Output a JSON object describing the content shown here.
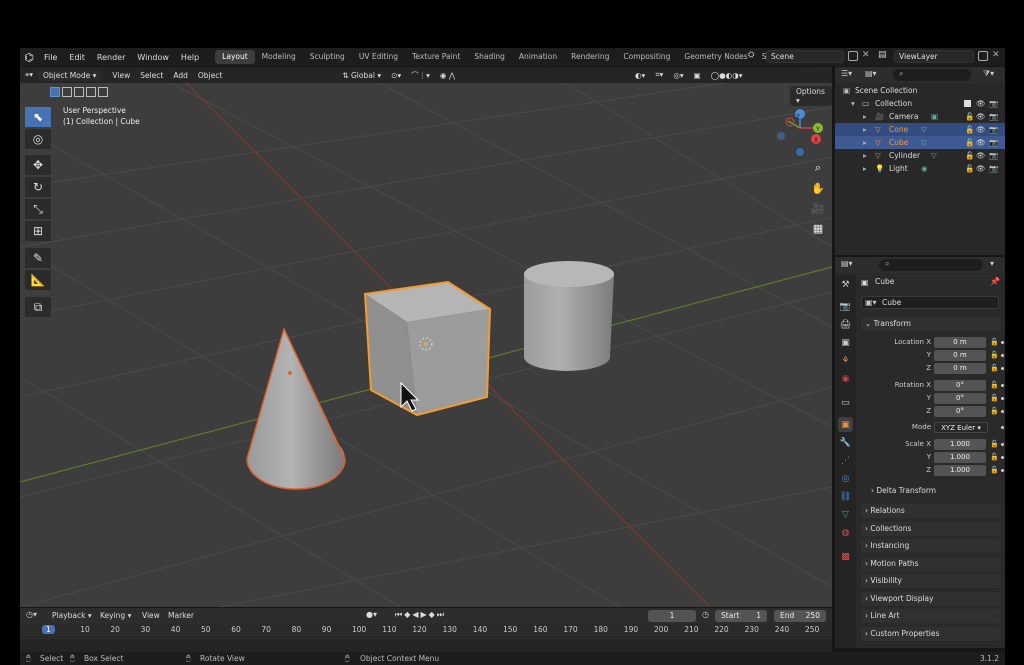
{
  "menu": [
    "File",
    "Edit",
    "Render",
    "Window",
    "Help"
  ],
  "workspaces": [
    "Layout",
    "Modeling",
    "Sculpting",
    "UV Editing",
    "Texture Paint",
    "Shading",
    "Animation",
    "Rendering",
    "Compositing",
    "Geometry Nodes",
    "Scripting"
  ],
  "workspace_add": "+",
  "scene": {
    "label": "Scene",
    "view_layer": "ViewLayer"
  },
  "viewport": {
    "mode": "Object Mode",
    "menus": [
      "View",
      "Select",
      "Add",
      "Object"
    ],
    "orientation": "Global",
    "options": "Options",
    "info_line1": "User Perspective",
    "info_line2": "(1) Collection | Cube",
    "gizmo": {
      "x": "X",
      "y": "Y",
      "z": "Z"
    }
  },
  "outliner": {
    "title": "Scene Collection",
    "collection": "Collection",
    "items": [
      {
        "label": "Camera",
        "color": "#dddddd"
      },
      {
        "label": "Cone",
        "color": "#f19640"
      },
      {
        "label": "Cube",
        "color": "#f19640"
      },
      {
        "label": "Cylinder",
        "color": "#dddddd"
      },
      {
        "label": "Light",
        "color": "#dddddd"
      }
    ]
  },
  "properties": {
    "object_name": "Cube",
    "data_name": "Cube",
    "transform_title": "Transform",
    "location_label": "Location X",
    "rotation_label": "Rotation X",
    "scale_label": "Scale X",
    "y_label": "Y",
    "z_label": "Z",
    "location": [
      "0 m",
      "0 m",
      "0 m"
    ],
    "rotation": [
      "0°",
      "0°",
      "0°"
    ],
    "mode_label": "Mode",
    "mode_value": "XYZ Euler",
    "scale": [
      "1.000",
      "1.000",
      "1.000"
    ],
    "delta_transform": "Delta Transform",
    "panels": [
      "Relations",
      "Collections",
      "Instancing",
      "Motion Paths",
      "Visibility",
      "Viewport Display",
      "Line Art",
      "Custom Properties"
    ]
  },
  "timeline": {
    "playback": "Playback",
    "keying": "Keying",
    "view": "View",
    "marker": "Marker",
    "current_frame": "1",
    "start_label": "Start",
    "start": "1",
    "end_label": "End",
    "end": "250",
    "ticks": [
      "1",
      "10",
      "20",
      "30",
      "40",
      "50",
      "60",
      "70",
      "80",
      "90",
      "100",
      "110",
      "120",
      "130",
      "140",
      "150",
      "160",
      "170",
      "180",
      "190",
      "200",
      "210",
      "220",
      "230",
      "240",
      "250"
    ]
  },
  "status": {
    "select": "Select",
    "box_select": "Box Select",
    "rotate_view": "Rotate View",
    "context_menu": "Object Context Menu",
    "version": "3.1.2"
  },
  "colors": {
    "accent": "#4772b3",
    "selection_outline": "#f39b2d",
    "active_object": "#f19640"
  }
}
